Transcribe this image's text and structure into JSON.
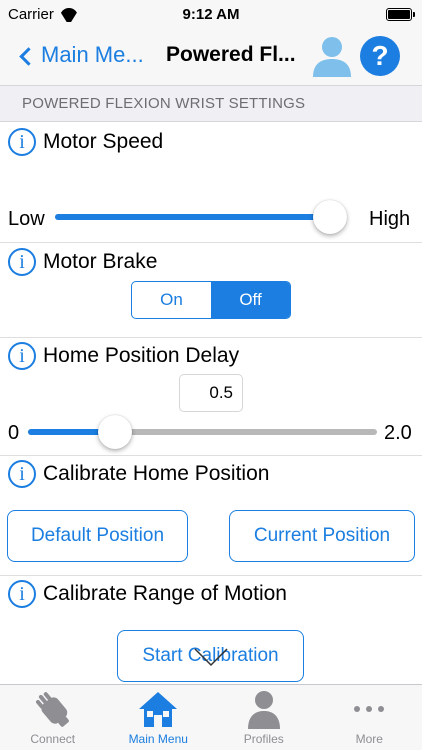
{
  "status_bar": {
    "carrier": "Carrier",
    "time": "9:12 AM"
  },
  "nav": {
    "back_label": "Main Me...",
    "title": "Powered Fl...",
    "help_glyph": "?"
  },
  "section_header": "POWERED FLEXION WRIST SETTINGS",
  "motor_speed": {
    "title": "Motor Speed",
    "min_label": "Low",
    "max_label": "High",
    "value": 1.0
  },
  "motor_brake": {
    "title": "Motor Brake",
    "on_label": "On",
    "off_label": "Off",
    "selected": "Off"
  },
  "home_delay": {
    "title": "Home Position Delay",
    "value": "0.5",
    "min_label": "0",
    "max_label": "2.0",
    "min": 0,
    "max": 2.0,
    "numeric_value": 0.5
  },
  "calibrate_home": {
    "title": "Calibrate Home Position",
    "default_button": "Default Position",
    "current_button": "Current Position"
  },
  "calibrate_range": {
    "title": "Calibrate Range of Motion",
    "start_button": "Start Calibration"
  },
  "tabs": [
    {
      "label": "Connect",
      "icon": "hand-icon",
      "active": false
    },
    {
      "label": "Main Menu",
      "icon": "home-icon",
      "active": true
    },
    {
      "label": "Profiles",
      "icon": "person-icon",
      "active": false
    },
    {
      "label": "More",
      "icon": "more-icon",
      "active": false
    }
  ],
  "colors": {
    "accent": "#1b7ee0",
    "inactive": "#8e8e93",
    "track": "#b8b8b8"
  }
}
